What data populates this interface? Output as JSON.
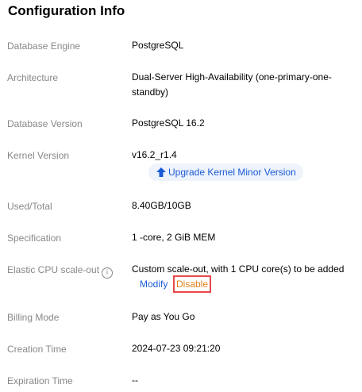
{
  "title": "Configuration Info",
  "rows": [
    {
      "label": "Database Engine",
      "value": "PostgreSQL"
    },
    {
      "label": "Architecture",
      "value": "Dual-Server High-Availability (one-primary-one-standby)"
    },
    {
      "label": "Database Version",
      "value": "PostgreSQL 16.2"
    },
    {
      "label": "Kernel Version",
      "value": "v16.2_r1.4"
    },
    {
      "label": "Used/Total",
      "value": "8.40GB/10GB"
    },
    {
      "label": "Specification",
      "value": "1 -core, 2 GiB MEM"
    },
    {
      "label": "Elastic CPU scale-out",
      "value": "Custom scale-out, with 1 CPU core(s) to be added"
    },
    {
      "label": "Billing Mode",
      "value": "Pay as You Go"
    },
    {
      "label": "Creation Time",
      "value": "2024-07-23 09:21:20"
    },
    {
      "label": "Expiration Time",
      "value": "--"
    }
  ],
  "kernel_upgrade_label": "Upgrade Kernel Minor Version",
  "elastic_actions": {
    "modify": "Modify",
    "disable": "Disable"
  },
  "info_icon_glyph": "i",
  "colors": {
    "link": "#1a5bd7",
    "disable": "#e0801a",
    "highlight_border": "#e8484a",
    "upgrade_bg": "#eef3fc"
  }
}
